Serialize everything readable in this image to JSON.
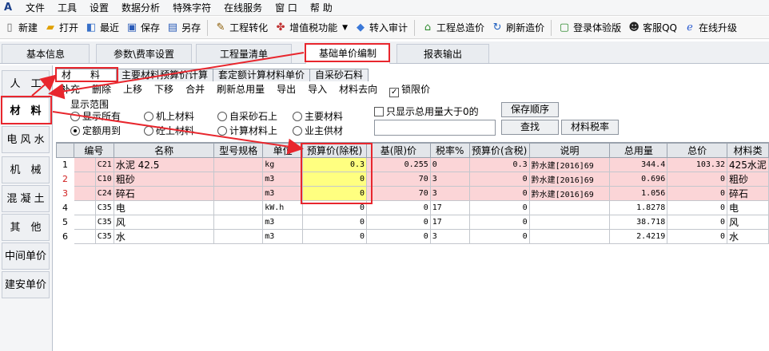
{
  "menu": [
    "文件",
    "工具",
    "设置",
    "数据分析",
    "特殊字符",
    "在线服务",
    "窗 口",
    "帮 助"
  ],
  "toolbar": [
    {
      "label": "新建",
      "icon": "new-file-icon"
    },
    {
      "label": "打开",
      "icon": "open-folder-icon"
    },
    {
      "label": "最近",
      "icon": "recent-icon"
    },
    {
      "label": "保存",
      "icon": "save-icon"
    },
    {
      "label": "另存",
      "icon": "save-as-icon"
    },
    {
      "label": "工程转化",
      "icon": "convert-icon"
    },
    {
      "label": "增值税功能",
      "icon": "tax-icon"
    },
    {
      "label": "转入审计",
      "icon": "audit-icon"
    },
    {
      "label": "工程总造价",
      "icon": "home-icon"
    },
    {
      "label": "刷新造价",
      "icon": "refresh-icon"
    },
    {
      "label": "登录体验版",
      "icon": "login-icon"
    },
    {
      "label": "客服QQ",
      "icon": "qq-icon"
    },
    {
      "label": "在线升级",
      "icon": "upgrade-icon"
    }
  ],
  "tabs": [
    "基本信息",
    "参数\\费率设置",
    "工程量清单",
    "基础单价编制",
    "报表输出"
  ],
  "sidebar": [
    "人　工",
    "材　料",
    "电 风 水",
    "机　械",
    "混 凝 土",
    "其　他",
    "中间单价",
    "建安单价"
  ],
  "subtabs": [
    "材　　料",
    "主要材料预算价计算",
    "套定额计算材料单价",
    "自采砂石料"
  ],
  "actions": [
    "补充",
    "删除",
    "上移",
    "下移",
    "合并",
    "刷新总用量",
    "导出",
    "导入",
    "材料去向"
  ],
  "lock_price_label": "锁限价",
  "filter": {
    "title": "显示范围",
    "radios": [
      "显示所有",
      "机上材料",
      "自采砂石上",
      "主要材料",
      "定额用到",
      "砼上材料",
      "计算材料上",
      "业主供材"
    ],
    "only_show_label": "只显示总用量大于0的",
    "save_order": "保存顺序",
    "search": "查找",
    "tax_rate": "材料税率"
  },
  "table": {
    "headers": [
      "编号",
      "名称",
      "型号规格",
      "单位",
      "预算价(除税)",
      "基(限)价",
      "税率%",
      "预算价(含税)",
      "说明",
      "总用量",
      "总价",
      "材料类"
    ],
    "rows": [
      {
        "n": "1",
        "code": "C21",
        "name": "水泥 42.5",
        "spec": "",
        "unit": "kg",
        "price": "0.3",
        "base": "0.255",
        "tax": "0",
        "price_tax": "0.3",
        "note": "黔水建[2016]69",
        "qty": "344.4",
        "total": "103.32",
        "cat": "425水泥"
      },
      {
        "n": "2",
        "code": "C10",
        "name": "粗砂",
        "spec": "",
        "unit": "m3",
        "price": "0",
        "base": "70",
        "tax": "3",
        "price_tax": "0",
        "note": "黔水建[2016]69",
        "qty": "0.696",
        "total": "0",
        "cat": "粗砂"
      },
      {
        "n": "3",
        "code": "C24",
        "name": "碎石",
        "spec": "",
        "unit": "m3",
        "price": "0",
        "base": "70",
        "tax": "3",
        "price_tax": "0",
        "note": "黔水建[2016]69",
        "qty": "1.056",
        "total": "0",
        "cat": "碎石"
      },
      {
        "n": "4",
        "code": "C35",
        "name": "电",
        "spec": "",
        "unit": "kW.h",
        "price": "0",
        "base": "0",
        "tax": "17",
        "price_tax": "0",
        "note": "",
        "qty": "1.8278",
        "total": "0",
        "cat": "电"
      },
      {
        "n": "5",
        "code": "C35",
        "name": "风",
        "spec": "",
        "unit": "m3",
        "price": "0",
        "base": "0",
        "tax": "17",
        "price_tax": "0",
        "note": "",
        "qty": "38.718",
        "total": "0",
        "cat": "风"
      },
      {
        "n": "6",
        "code": "C35",
        "name": "水",
        "spec": "",
        "unit": "m3",
        "price": "0",
        "base": "0",
        "tax": "3",
        "price_tax": "0",
        "note": "",
        "qty": "2.4219",
        "total": "0",
        "cat": "水"
      }
    ]
  },
  "colors": {
    "highlight": "#e8262d",
    "row_highlight": "#fbd5d7",
    "price_cell": "#ffff80"
  }
}
